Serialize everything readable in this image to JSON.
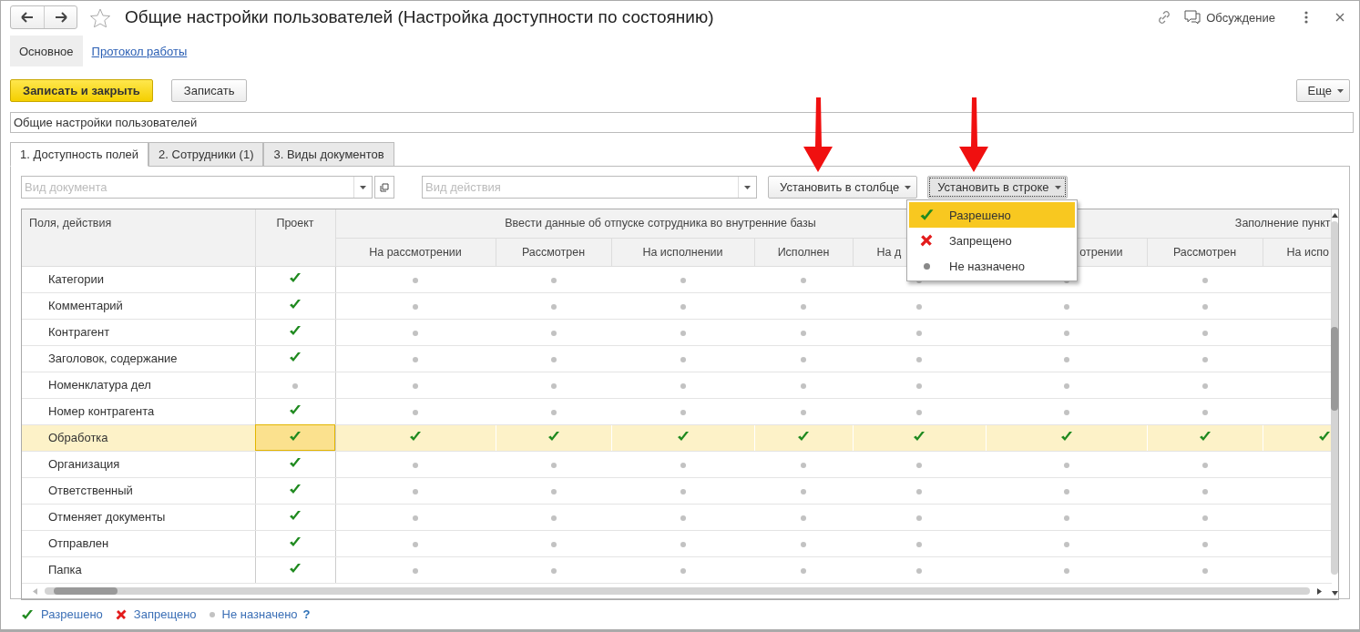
{
  "window": {
    "title": "Общие настройки пользователей (Настройка доступности по состоянию)",
    "discussion": "Обсуждение"
  },
  "sections": [
    {
      "label": "Основное",
      "selected": true
    },
    {
      "label": "Протокол работы",
      "selected": false
    }
  ],
  "toolbar": {
    "primary": "Записать и закрыть",
    "secondary": "Записать",
    "more": "Еще"
  },
  "name_field": {
    "value": "Общие настройки пользователей"
  },
  "tabs": [
    {
      "label": "1. Доступность полей",
      "selected": true
    },
    {
      "label": "2. Сотрудники (1)",
      "selected": false
    },
    {
      "label": "3. Виды документов",
      "selected": false
    }
  ],
  "filters": {
    "document_type": {
      "placeholder": "Вид документа"
    },
    "action_type": {
      "placeholder": "Вид действия"
    },
    "set_column": "Установить в столбце",
    "set_row": "Установить в строке"
  },
  "table": {
    "columns": {
      "field": "Поля, действия",
      "project": "Проект"
    },
    "groups": [
      {
        "label": "Ввести данные об отпуске сотрудника во внутренние базы",
        "kind": "whole",
        "columns": [
          {
            "label": "На рассмотрении",
            "kind": "whole"
          },
          {
            "label": "Рассмотрен",
            "kind": "whole"
          },
          {
            "label": "На исполнении",
            "kind": "whole"
          },
          {
            "label": "Исполнен",
            "kind": "whole"
          },
          {
            "label": "На д",
            "kind": "right-cut"
          }
        ]
      },
      {
        "label": "Заполнение пункт",
        "kind": "right-cut",
        "columns": [
          {
            "label": "отрении",
            "kind": "left-cut"
          },
          {
            "label": "Рассмотрен",
            "kind": "whole"
          },
          {
            "label": "На испо",
            "kind": "right-cut"
          }
        ]
      }
    ],
    "rows": [
      {
        "label": "Категории",
        "selected": false,
        "project": {
          "kind": "allowed"
        },
        "values": [
          {
            "kind": "unset"
          },
          {
            "kind": "unset"
          },
          {
            "kind": "unset"
          },
          {
            "kind": "unset"
          },
          {
            "kind": "unset"
          },
          {
            "kind": "unset"
          },
          {
            "kind": "unset"
          }
        ]
      },
      {
        "label": "Комментарий",
        "selected": false,
        "project": {
          "kind": "allowed"
        },
        "values": [
          {
            "kind": "unset"
          },
          {
            "kind": "unset"
          },
          {
            "kind": "unset"
          },
          {
            "kind": "unset"
          },
          {
            "kind": "unset"
          },
          {
            "kind": "unset"
          },
          {
            "kind": "unset"
          }
        ]
      },
      {
        "label": "Контрагент",
        "selected": false,
        "project": {
          "kind": "allowed"
        },
        "values": [
          {
            "kind": "unset"
          },
          {
            "kind": "unset"
          },
          {
            "kind": "unset"
          },
          {
            "kind": "unset"
          },
          {
            "kind": "unset"
          },
          {
            "kind": "unset"
          },
          {
            "kind": "unset"
          }
        ]
      },
      {
        "label": "Заголовок, содержание",
        "selected": false,
        "project": {
          "kind": "allowed"
        },
        "values": [
          {
            "kind": "unset"
          },
          {
            "kind": "unset"
          },
          {
            "kind": "unset"
          },
          {
            "kind": "unset"
          },
          {
            "kind": "unset"
          },
          {
            "kind": "unset"
          },
          {
            "kind": "unset"
          }
        ]
      },
      {
        "label": "Номенклатура дел",
        "selected": false,
        "project": {
          "kind": "unset"
        },
        "values": [
          {
            "kind": "unset"
          },
          {
            "kind": "unset"
          },
          {
            "kind": "unset"
          },
          {
            "kind": "unset"
          },
          {
            "kind": "unset"
          },
          {
            "kind": "unset"
          },
          {
            "kind": "unset"
          }
        ]
      },
      {
        "label": "Номер контрагента",
        "selected": false,
        "project": {
          "kind": "allowed"
        },
        "values": [
          {
            "kind": "unset"
          },
          {
            "kind": "unset"
          },
          {
            "kind": "unset"
          },
          {
            "kind": "unset"
          },
          {
            "kind": "unset"
          },
          {
            "kind": "unset"
          },
          {
            "kind": "unset"
          }
        ]
      },
      {
        "label": "Обработка",
        "selected": true,
        "project": {
          "kind": "allowed"
        },
        "values": [
          {
            "kind": "allowed"
          },
          {
            "kind": "allowed"
          },
          {
            "kind": "allowed"
          },
          {
            "kind": "allowed"
          },
          {
            "kind": "allowed"
          },
          {
            "kind": "allowed"
          },
          {
            "kind": "allowed"
          },
          {
            "kind": "allowed"
          }
        ]
      },
      {
        "label": "Организация",
        "selected": false,
        "project": {
          "kind": "allowed"
        },
        "values": [
          {
            "kind": "unset"
          },
          {
            "kind": "unset"
          },
          {
            "kind": "unset"
          },
          {
            "kind": "unset"
          },
          {
            "kind": "unset"
          },
          {
            "kind": "unset"
          },
          {
            "kind": "unset"
          }
        ]
      },
      {
        "label": "Ответственный",
        "selected": false,
        "project": {
          "kind": "allowed"
        },
        "values": [
          {
            "kind": "unset"
          },
          {
            "kind": "unset"
          },
          {
            "kind": "unset"
          },
          {
            "kind": "unset"
          },
          {
            "kind": "unset"
          },
          {
            "kind": "unset"
          },
          {
            "kind": "unset"
          }
        ]
      },
      {
        "label": "Отменяет документы",
        "selected": false,
        "project": {
          "kind": "allowed"
        },
        "values": [
          {
            "kind": "unset"
          },
          {
            "kind": "unset"
          },
          {
            "kind": "unset"
          },
          {
            "kind": "unset"
          },
          {
            "kind": "unset"
          },
          {
            "kind": "unset"
          },
          {
            "kind": "unset"
          }
        ]
      },
      {
        "label": "Отправлен",
        "selected": false,
        "project": {
          "kind": "allowed"
        },
        "values": [
          {
            "kind": "unset"
          },
          {
            "kind": "unset"
          },
          {
            "kind": "unset"
          },
          {
            "kind": "unset"
          },
          {
            "kind": "unset"
          },
          {
            "kind": "unset"
          },
          {
            "kind": "unset"
          }
        ]
      },
      {
        "label": "Папка",
        "selected": false,
        "project": {
          "kind": "allowed"
        },
        "values": [
          {
            "kind": "unset"
          },
          {
            "kind": "unset"
          },
          {
            "kind": "unset"
          },
          {
            "kind": "unset"
          },
          {
            "kind": "unset"
          },
          {
            "kind": "unset"
          },
          {
            "kind": "unset"
          }
        ]
      }
    ]
  },
  "menu": {
    "items": [
      {
        "kind": "allowed",
        "label": "Разрешено",
        "selected": true
      },
      {
        "kind": "denied",
        "label": "Запрещено",
        "selected": false
      },
      {
        "kind": "unset",
        "label": "Не назначено",
        "selected": false
      }
    ]
  },
  "legend": {
    "items": [
      {
        "kind": "allowed",
        "label": "Разрешено"
      },
      {
        "kind": "denied",
        "label": "Запрещено"
      },
      {
        "kind": "unset",
        "label": "Не назначено"
      }
    ],
    "help": "?"
  }
}
